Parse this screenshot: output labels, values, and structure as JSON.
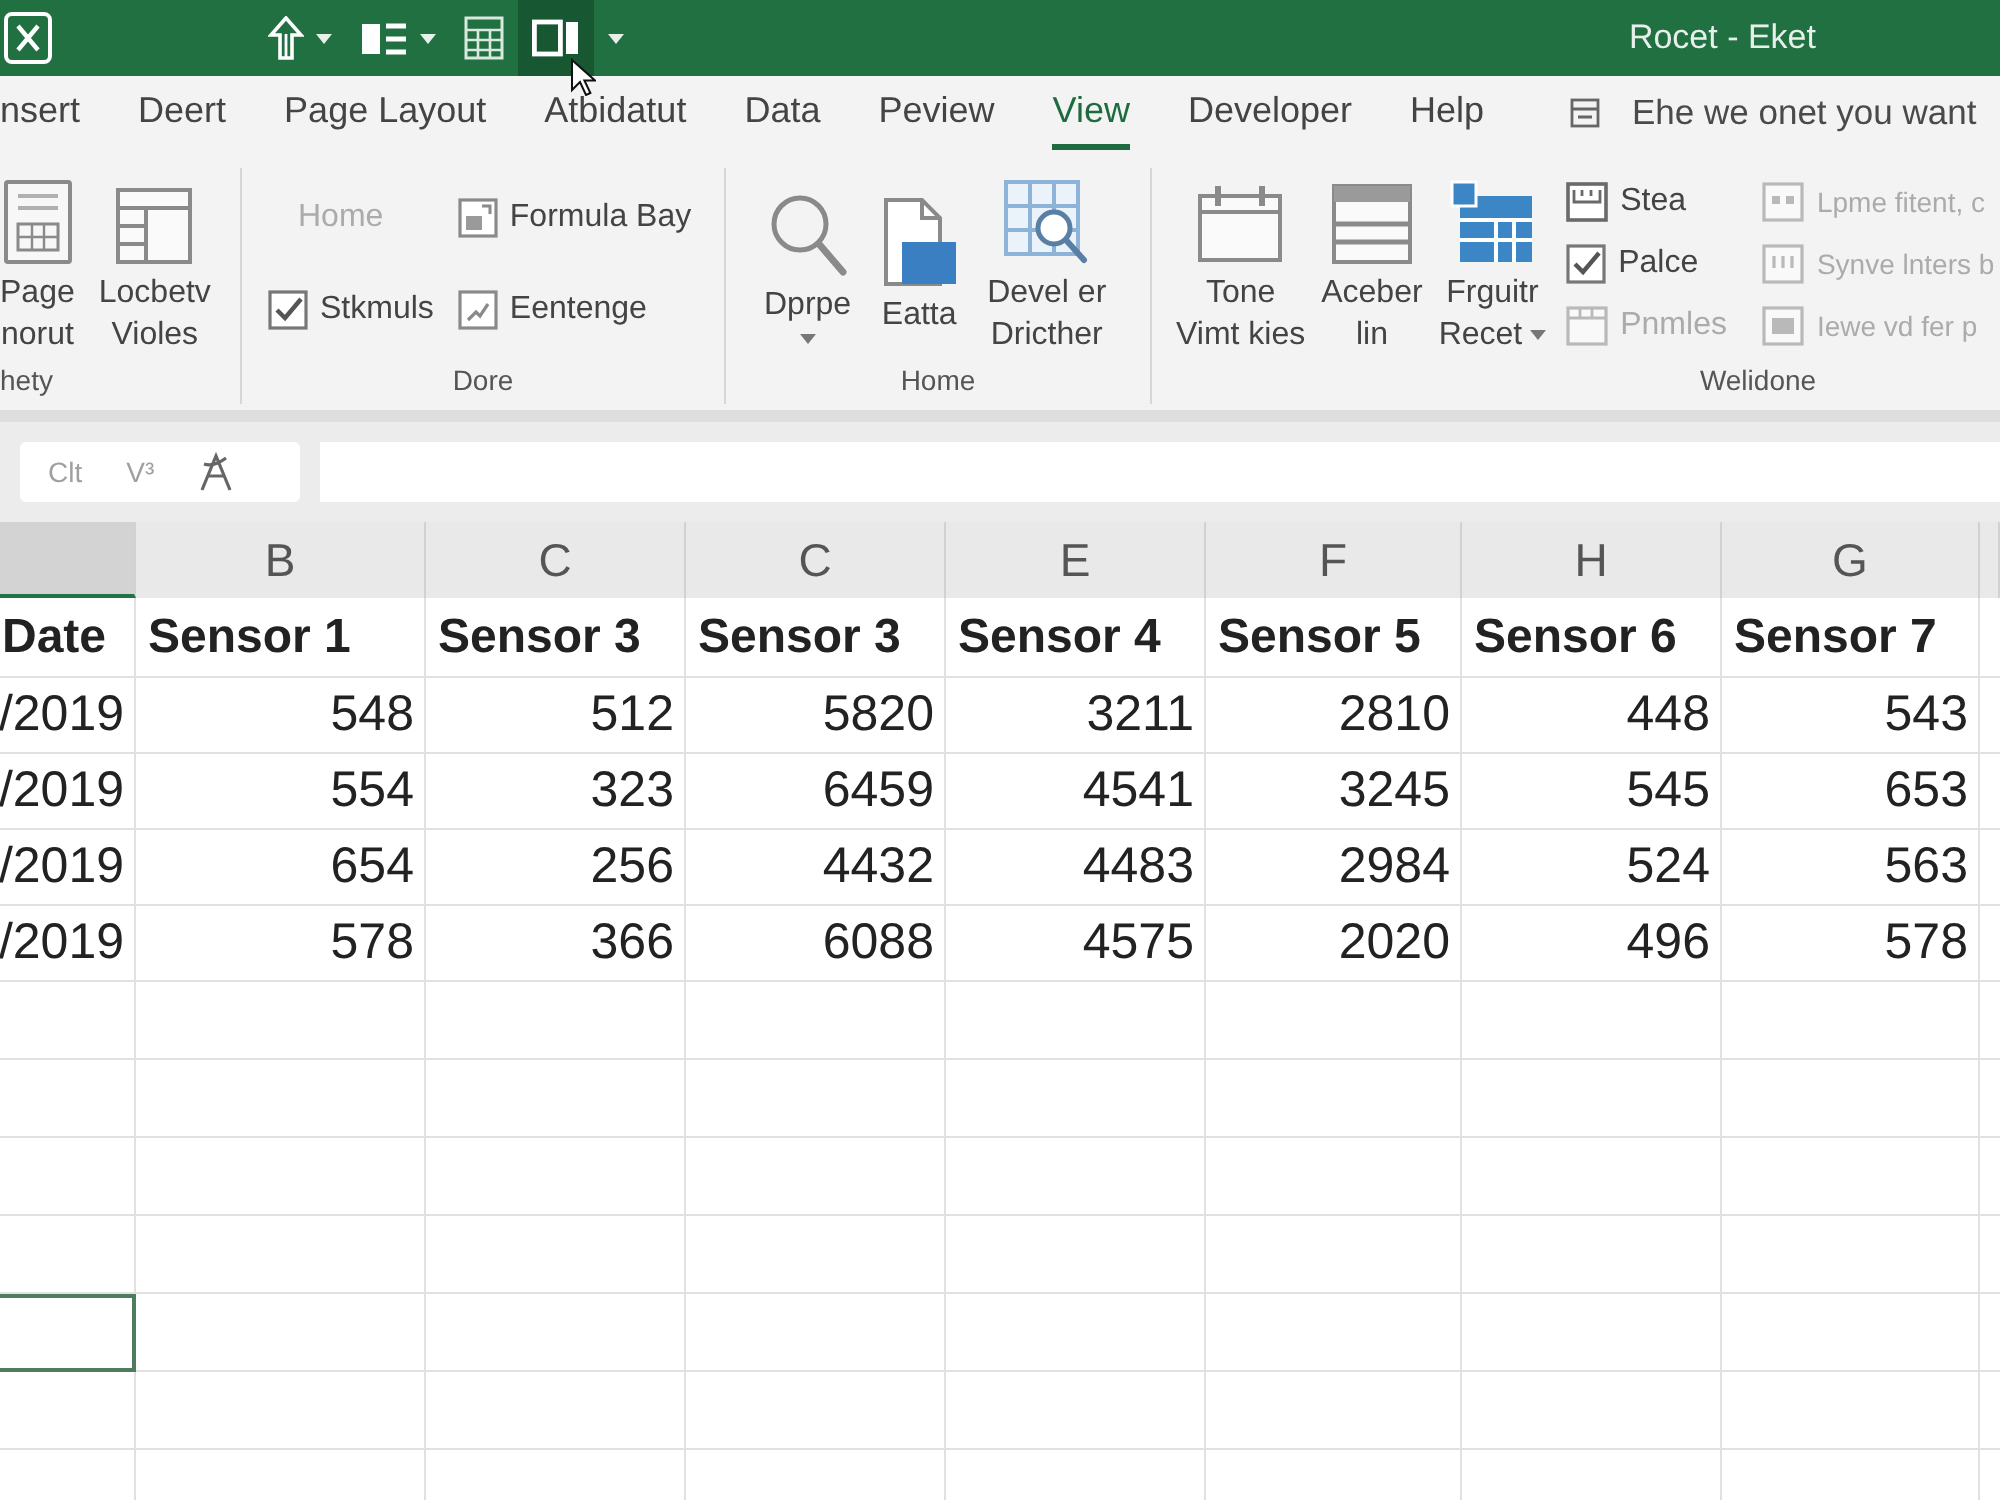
{
  "window": {
    "title": "Rocet - Eket",
    "quick_access": [
      {
        "hovered": false
      },
      {
        "hovered": false
      },
      {
        "hovered": false
      },
      {
        "hovered": true
      },
      {
        "hovered": false
      }
    ]
  },
  "ribbon_tabs": [
    {
      "label": "nsert",
      "selected": false
    },
    {
      "label": "Deert",
      "selected": false
    },
    {
      "label": "Page Layout",
      "selected": false
    },
    {
      "label": "Atbidatut",
      "selected": false
    },
    {
      "label": "Data",
      "selected": false
    },
    {
      "label": "Peview",
      "selected": false
    },
    {
      "label": "View",
      "selected": true
    },
    {
      "label": "Developer",
      "selected": false
    },
    {
      "label": "Help",
      "selected": false
    }
  ],
  "tell_me": {
    "placeholder": "Ehe we onet you want"
  },
  "ribbon_groups": [
    {
      "label": "hety",
      "columns": [
        [
          {
            "kind": "large",
            "label": "Page\nnorut",
            "disabled": false
          }
        ],
        [
          {
            "kind": "large",
            "label": "Locbetv\nVioles",
            "disabled": false
          }
        ]
      ]
    },
    {
      "label": "Dore",
      "columns": [
        [
          {
            "kind": "small",
            "label": "Home",
            "disabled": true
          },
          {
            "kind": "checkbox",
            "label": "Stkmuls",
            "checked": true,
            "disabled": false
          }
        ],
        [
          {
            "kind": "small",
            "label": "Formula Bay",
            "disabled": false
          },
          {
            "kind": "small",
            "label": "Eentenge",
            "disabled": false
          }
        ]
      ]
    },
    {
      "label": "Home",
      "columns": [
        [
          {
            "kind": "large",
            "label": "Dprpe",
            "dropdown": true,
            "disabled": false
          }
        ],
        [
          {
            "kind": "large",
            "label": "Eatta",
            "disabled": false
          }
        ],
        [
          {
            "kind": "large",
            "label": "Devel er\nDricther",
            "disabled": false
          }
        ]
      ]
    },
    {
      "label": "Welidone",
      "columns": [
        [
          {
            "kind": "large",
            "label": "Tone\nVimt kies",
            "disabled": false
          }
        ],
        [
          {
            "kind": "large",
            "label": "Aceber\nlin",
            "disabled": false
          }
        ],
        [
          {
            "kind": "large",
            "label": "Frguitr\nRecet",
            "dropdown": true,
            "disabled": false
          }
        ],
        [
          {
            "kind": "small",
            "label": "Stea",
            "disabled": false
          },
          {
            "kind": "checkbox",
            "label": "Palce",
            "checked": true,
            "disabled": false
          },
          {
            "kind": "small",
            "label": "Pnmles",
            "disabled": true
          }
        ],
        [
          {
            "kind": "small",
            "label": "Lpme fitent, c",
            "disabled": true
          },
          {
            "kind": "small",
            "label": "Synve lnters b",
            "disabled": true
          },
          {
            "kind": "small",
            "label": "Iewe vd fer p",
            "disabled": true
          }
        ]
      ]
    }
  ],
  "formula_bar": {
    "buttons": [
      "Clt",
      "V³"
    ]
  },
  "sheet": {
    "column_headers": [
      {
        "selected": true
      },
      {
        "label": "B",
        "selected": false
      },
      {
        "label": "C",
        "selected": false
      },
      {
        "label": "C",
        "selected": false
      },
      {
        "label": "E",
        "selected": false
      },
      {
        "label": "F",
        "selected": false
      },
      {
        "label": "H",
        "selected": false
      },
      {
        "label": "G",
        "selected": false
      }
    ],
    "rows": [
      {
        "kind": "header",
        "selected": false,
        "cells": [
          "Date",
          "Sensor 1",
          "Sensor 3",
          "Sensor 3",
          "Sensor 4",
          "Sensor 5",
          "Sensor 6",
          "Sensor 7"
        ]
      },
      {
        "kind": "data",
        "selected": false,
        "cells": [
          "/2019",
          "548",
          "512",
          "5820",
          "3211",
          "2810",
          "448",
          "543"
        ]
      },
      {
        "kind": "data",
        "selected": false,
        "cells": [
          "/2019",
          "554",
          "323",
          "6459",
          "4541",
          "3245",
          "545",
          "653"
        ]
      },
      {
        "kind": "data",
        "selected": false,
        "cells": [
          "/2019",
          "654",
          "256",
          "4432",
          "4483",
          "2984",
          "524",
          "563"
        ]
      },
      {
        "kind": "data",
        "selected": false,
        "cells": [
          "/2019",
          "578",
          "366",
          "6088",
          "4575",
          "2020",
          "496",
          "578"
        ]
      },
      {
        "kind": "empty",
        "selected": false
      },
      {
        "kind": "empty",
        "selected": false
      },
      {
        "kind": "empty",
        "selected": false
      },
      {
        "kind": "empty",
        "selected": false
      },
      {
        "kind": "empty",
        "selected": true
      },
      {
        "kind": "empty",
        "selected": false
      },
      {
        "kind": "empty",
        "selected": false
      }
    ]
  }
}
